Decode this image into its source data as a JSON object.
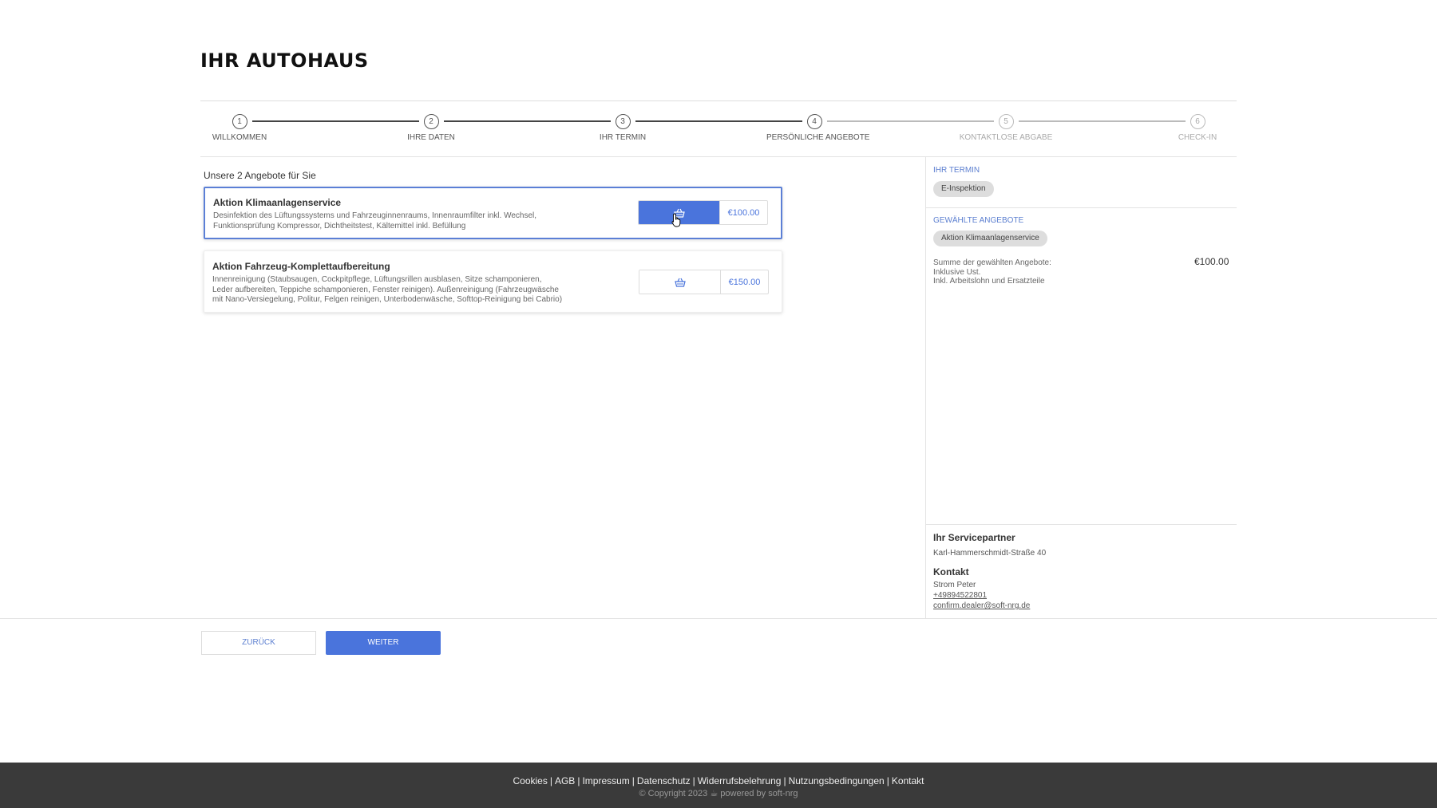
{
  "header": {
    "brand": "IHR AUTOHAUS"
  },
  "stepper": {
    "steps": [
      {
        "number": "1",
        "label": "WILLKOMMEN"
      },
      {
        "number": "2",
        "label": "IHRE DATEN"
      },
      {
        "number": "3",
        "label": "IHR TERMIN"
      },
      {
        "number": "4",
        "label": "PERSÖNLICHE ANGEBOTE"
      },
      {
        "number": "5",
        "label": "KONTAKTLOSE ABGABE"
      },
      {
        "number": "6",
        "label": "CHECK-IN"
      }
    ],
    "active_step": 4
  },
  "offers": {
    "title": "Unsere 2 Angebote für Sie",
    "items": [
      {
        "title": "Aktion Klimaanlagenservice",
        "desc_line1": "Desinfektion des Lüftungssystems und Fahrzeuginnenraums, Innenraumfilter inkl. Wechsel,",
        "desc_line2": "Funktionsprüfung Kompressor, Dichtheitstest, Kältemittel inkl. Befüllung",
        "desc_line3": "",
        "price": "€100.00",
        "selected": true,
        "cart_icon": "basket-icon"
      },
      {
        "title": "Aktion Fahrzeug-Komplettaufbereitung",
        "desc_line1": "Innenreinigung (Staubsaugen, Cockpitpflege, Lüftungsrillen ausblasen, Sitze schamponieren,",
        "desc_line2": "Leder aufbereiten, Teppiche schamponieren, Fenster reinigen). Außenreinigung (Fahrzeugwäsche",
        "desc_line3": "mit Nano-Versiegelung, Politur, Felgen reinigen, Unterbodenwäsche, Softtop-Reinigung bei Cabrio)",
        "price": "€150.00",
        "selected": false,
        "cart_icon": "basket-icon"
      }
    ]
  },
  "sidebar": {
    "appointment_label": "IHR TERMIN",
    "appointment_chip": "E-Inspektion",
    "selected_label": "GEWÄHLTE ANGEBOTE",
    "selected_chip": "Aktion Klimaanlagenservice",
    "sum_label": "Summe der gewählten Angebote:",
    "sum_note1": "Inklusive Ust.",
    "sum_note2": "Inkl. Arbeitslohn und Ersatzteile",
    "sum_amount": "€100.00",
    "partner_title": "Ihr Servicepartner",
    "partner_address": "Karl-Hammerschmidt-Straße 40",
    "contact_title": "Kontakt",
    "contact_name": "Strom Peter",
    "contact_phone": "+49894522801",
    "contact_email": "confirm.dealer@soft-nrg.de"
  },
  "nav": {
    "back_label": "ZURÜCK",
    "next_label": "WEITER"
  },
  "footer": {
    "links": [
      "Cookies",
      "AGB",
      "Impressum",
      "Datenschutz",
      "Widerrufsbelehrung",
      "Nutzungsbedingungen",
      "Kontakt"
    ],
    "copyright": "© Copyright 2023",
    "powered": "powered by soft-nrg"
  },
  "colors": {
    "accent": "#4a74dc",
    "footer_bg": "#3a3a3a",
    "label_blue": "#5c7fd0"
  }
}
